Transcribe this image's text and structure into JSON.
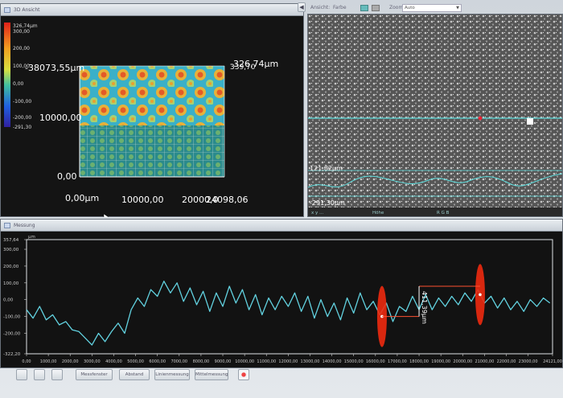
{
  "top_left": {
    "title": "3D Ansicht",
    "legend_labels": [
      "326,74µm",
      "300,00",
      "200,00",
      "100,00",
      "0,00",
      "-100,00",
      "-200,00",
      "-291,30"
    ],
    "axis_texts": {
      "x_start": "0,00µm",
      "x_mid": "10000,00",
      "x_end": "20000,0",
      "x_max": "24098,06",
      "y_mid": "10000,00",
      "y_zero": "0,00",
      "top_left_coord": "-38073,55µm",
      "top_right_coord": "-326,74µm",
      "top_right_coord2": "339,70"
    }
  },
  "top_right": {
    "toolbar": {
      "ansicht_label": "Ansicht:",
      "ansicht_value": "Farbe",
      "zoom_label": "Zoom",
      "zoom_value": "Auto"
    },
    "profile_top_value": "121,82µm",
    "profile_bottom_value": "-291,30µm",
    "status": {
      "left": "x  y  ...",
      "mid": "Höhe",
      "right": "R  G  B"
    }
  },
  "bottom": {
    "title": "Messung",
    "y_unit": "µm",
    "y_max": "357,64",
    "y_min": "-322,20",
    "measure_label": "411,39µm",
    "buttons": {
      "b1": "Messfenster",
      "b2": "Abstand",
      "b3": "Linienmessung",
      "b4": "Mittelmessung"
    }
  },
  "chart_data": {
    "type": "line",
    "title": "",
    "xlabel": "",
    "ylabel": "µm",
    "xlim": [
      0,
      24121
    ],
    "ylim": [
      -322.2,
      357.64
    ],
    "x_ticks": [
      "0,00",
      "1000,00",
      "2000,00",
      "3000,00",
      "4000,00",
      "5000,00",
      "6000,00",
      "7000,00",
      "8000,00",
      "9000,00",
      "10000,00",
      "11000,00",
      "12000,00",
      "13000,00",
      "14000,00",
      "15000,00",
      "16000,00",
      "17000,00",
      "18000,00",
      "19000,00",
      "20000,00",
      "21000,00",
      "22000,00",
      "23000,00",
      "24121,00"
    ],
    "y_ticks": [
      "357,64",
      "300,00",
      "200,00",
      "100,00",
      "0,00",
      "-100,00",
      "-200,00",
      "-322,20"
    ],
    "series": [
      {
        "x": [
          0,
          300,
          600,
          900,
          1200,
          1500,
          1800,
          2100,
          2400,
          2700,
          3000,
          3300,
          3600,
          3900,
          4200,
          4500,
          4800,
          5100,
          5400,
          5700,
          6000,
          6300,
          6600,
          6900,
          7200,
          7500,
          7800,
          8100,
          8400,
          8700,
          9000,
          9300,
          9600,
          9900,
          10200,
          10500,
          10800,
          11100,
          11400,
          11700,
          12000,
          12300,
          12600,
          12900,
          13200,
          13500,
          13800,
          14100,
          14400,
          14700,
          15000,
          15300,
          15600,
          15900,
          16200,
          16500,
          16800,
          17100,
          17400,
          17700,
          18000,
          18300,
          18600,
          18900,
          19200,
          19500,
          19800,
          20100,
          20400,
          20700,
          21000,
          21300,
          21600,
          21900,
          22200,
          22500,
          22800,
          23100,
          23400,
          23700,
          24000
        ],
        "values": [
          -60,
          -110,
          -40,
          -120,
          -90,
          -150,
          -130,
          -180,
          -190,
          -230,
          -270,
          -200,
          -250,
          -190,
          -140,
          -200,
          -60,
          10,
          -40,
          60,
          20,
          110,
          40,
          100,
          -10,
          70,
          -30,
          50,
          -70,
          40,
          -40,
          80,
          -20,
          60,
          -60,
          30,
          -90,
          10,
          -60,
          20,
          -40,
          40,
          -70,
          20,
          -110,
          0,
          -100,
          -20,
          -120,
          10,
          -80,
          40,
          -60,
          -10,
          -90,
          -20,
          -130,
          -40,
          -70,
          20,
          -60,
          30,
          -60,
          10,
          -40,
          20,
          -30,
          40,
          -10,
          60,
          -20,
          20,
          -50,
          10,
          -60,
          -10,
          -70,
          0,
          -40,
          10,
          -20
        ]
      }
    ],
    "annotations": [
      {
        "label": "411,39µm",
        "from": {
          "x": 16300,
          "y": -100
        },
        "to": {
          "x": 18000,
          "y": 80
        }
      },
      {
        "marker": "red-ellipse",
        "x": 16300
      },
      {
        "marker": "red-ellipse",
        "x": 20800
      }
    ]
  }
}
